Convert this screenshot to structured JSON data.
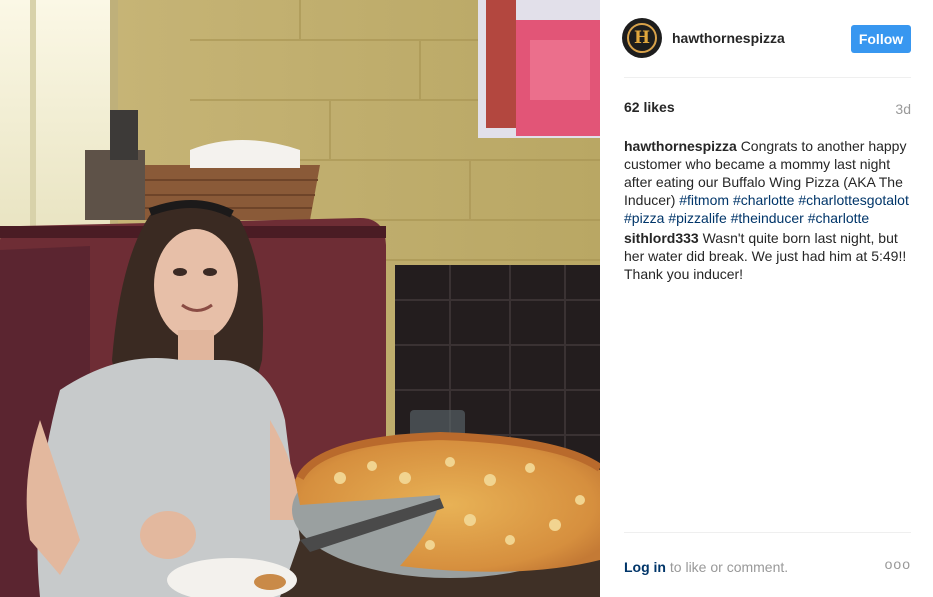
{
  "post": {
    "photo_icon": "post-photo-woman-with-pizza",
    "photo_alt": ""
  },
  "header": {
    "avatar_letter": "H",
    "username": "hawthornespizza",
    "follow_label": "Follow"
  },
  "stats": {
    "likes": "62 likes",
    "time": "3d"
  },
  "caption": {
    "author": "hawthornespizza",
    "text": "Congrats to another happy customer who became a mommy last night after eating our Buffalo Wing Pizza (AKA The Inducer)",
    "tags": [
      "#fitmom",
      "#charlotte",
      "#charlottesgotalot",
      "#pizza",
      "#pizzalife",
      "#theinducer",
      "#charlotte"
    ]
  },
  "comment": {
    "author": "sithlord333",
    "text": "Wasn't quite born last night, but her water did break. We just had him at 5:49!! Thank you inducer!"
  },
  "footer": {
    "login_link": "Log in",
    "login_text": "to like or comment.",
    "more_icon": "ellipsis-icon",
    "more_text": "ooo"
  },
  "colors": {
    "follow_bg": "#3897f0",
    "link": "#003569",
    "muted": "#999999",
    "text": "#262626"
  }
}
